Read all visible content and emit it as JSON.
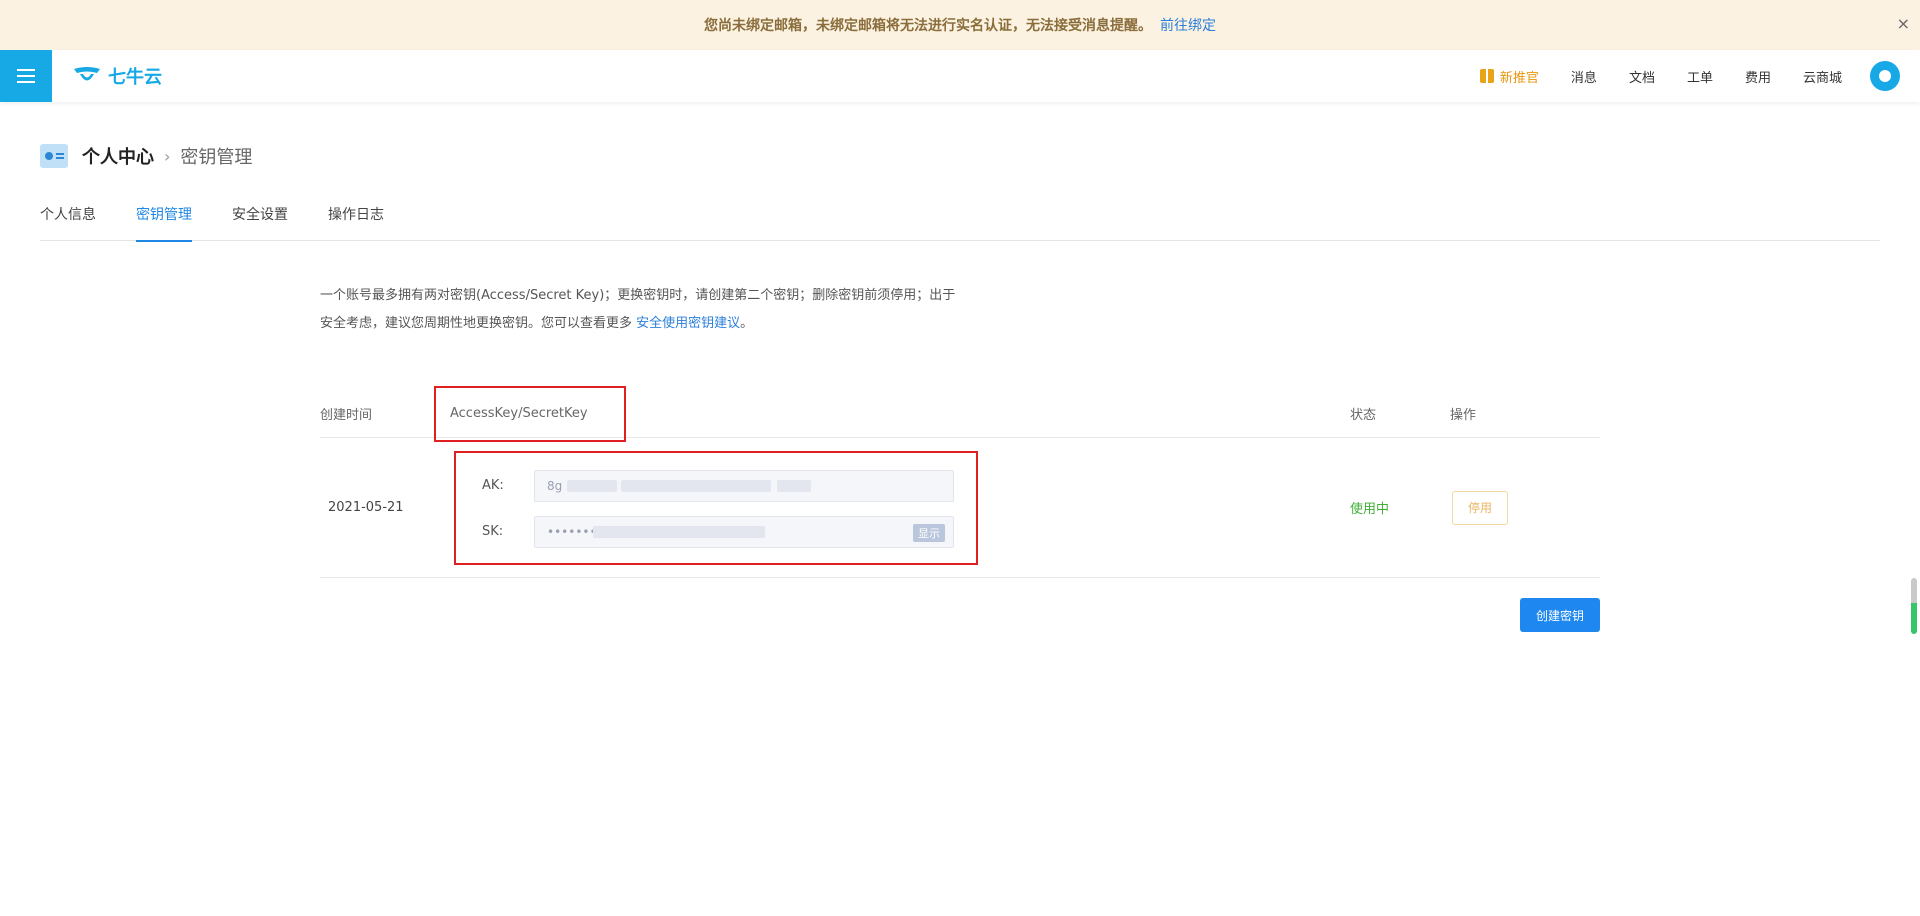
{
  "notice": {
    "message": "您尚未绑定邮箱，未绑定邮箱将无法进行实名认证，无法接受消息提醒。",
    "link": "前往绑定",
    "close": "×"
  },
  "header": {
    "logo_text": "七牛云",
    "nav": {
      "new_recommend": "新推官",
      "messages": "消息",
      "docs": "文档",
      "tickets": "工单",
      "billing": "费用",
      "mall": "云商城"
    }
  },
  "breadcrumb": {
    "root": "个人中心",
    "separator": "›",
    "current": "密钥管理"
  },
  "tabs": [
    {
      "label": "个人信息"
    },
    {
      "label": "密钥管理"
    },
    {
      "label": "安全设置"
    },
    {
      "label": "操作日志"
    }
  ],
  "description": {
    "text": "一个账号最多拥有两对密钥(Access/Secret Key)；更换密钥时，请创建第二个密钥；删除密钥前须停用；出于安全考虑，建议您周期性地更换密钥。您可以查看更多",
    "link": "安全使用密钥建议",
    "end": "。"
  },
  "table": {
    "headers": {
      "time": "创建时间",
      "key": "AccessKey/SecretKey",
      "status": "状态",
      "op": "操作"
    },
    "rows": [
      {
        "date": "2021-05-21",
        "ak_label": "AK:",
        "ak_prefix": "8g",
        "sk_label": "SK:",
        "sk_mask": "••••••••",
        "show_label": "显示",
        "status": "使用中",
        "op_label": "停用"
      }
    ]
  },
  "create_button": "创建密钥",
  "colors": {
    "brand": "#17a8e6",
    "link": "#2b7fdb",
    "active": "#1f88e5",
    "status_active": "#3fae33",
    "highlight_box": "#e02020"
  }
}
